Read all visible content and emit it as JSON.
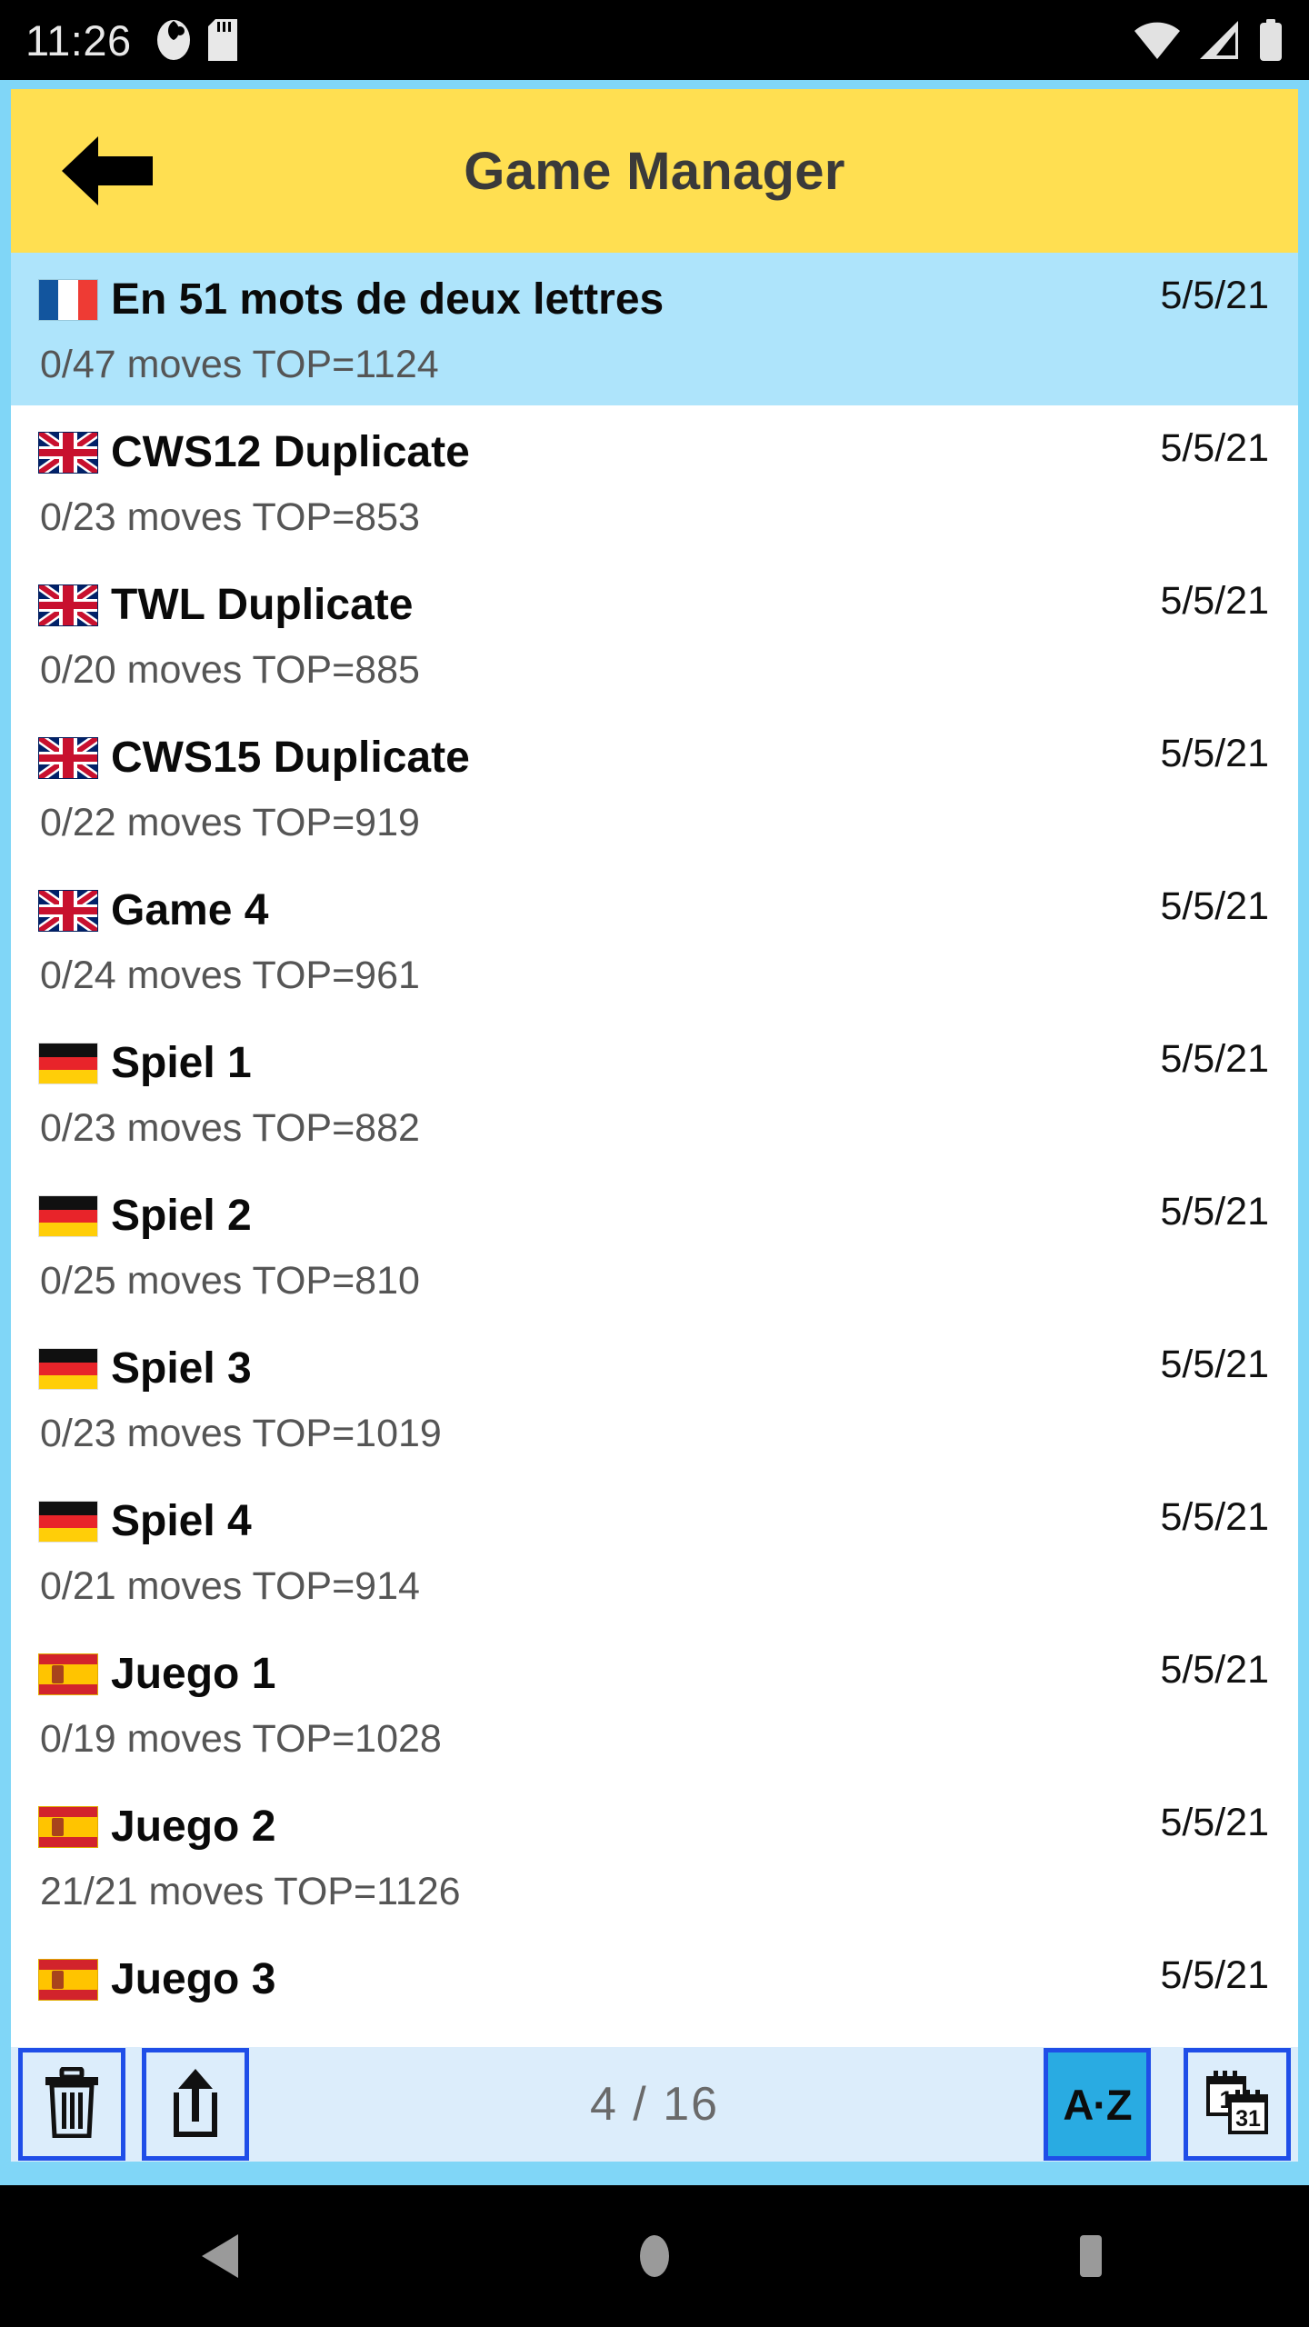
{
  "status_bar": {
    "time": "11:26",
    "left_icons": [
      "app-notification-icon",
      "sd-card-icon"
    ],
    "right_icons": [
      "wifi-icon",
      "cellular-signal-icon",
      "battery-icon"
    ]
  },
  "header": {
    "title": "Game Manager",
    "back_icon": "back-arrow-icon",
    "background_color": "#FFDF51",
    "title_color": "#3A3A3A"
  },
  "list": {
    "selected_index": 0,
    "selected_color": "#AEE4FB",
    "rows": [
      {
        "flag": "fr",
        "title": "En 51 mots de deux lettres",
        "subtitle": "0/47 moves TOP=1124",
        "date": "5/5/21"
      },
      {
        "flag": "gb",
        "title": "CWS12 Duplicate",
        "subtitle": "0/23 moves TOP=853",
        "date": "5/5/21"
      },
      {
        "flag": "gb",
        "title": "TWL Duplicate",
        "subtitle": "0/20 moves TOP=885",
        "date": "5/5/21"
      },
      {
        "flag": "gb",
        "title": "CWS15 Duplicate",
        "subtitle": "0/22 moves TOP=919",
        "date": "5/5/21"
      },
      {
        "flag": "gb",
        "title": "Game 4",
        "subtitle": "0/24 moves TOP=961",
        "date": "5/5/21"
      },
      {
        "flag": "de",
        "title": "Spiel 1",
        "subtitle": "0/23 moves TOP=882",
        "date": "5/5/21"
      },
      {
        "flag": "de",
        "title": "Spiel 2",
        "subtitle": "0/25 moves TOP=810",
        "date": "5/5/21"
      },
      {
        "flag": "de",
        "title": "Spiel 3",
        "subtitle": "0/23 moves TOP=1019",
        "date": "5/5/21"
      },
      {
        "flag": "de",
        "title": "Spiel 4",
        "subtitle": "0/21 moves TOP=914",
        "date": "5/5/21"
      },
      {
        "flag": "es",
        "title": "Juego 1",
        "subtitle": "0/19 moves TOP=1028",
        "date": "5/5/21"
      },
      {
        "flag": "es",
        "title": "Juego 2",
        "subtitle": "21/21 moves TOP=1126",
        "date": "5/5/21"
      },
      {
        "flag": "es",
        "title": "Juego 3",
        "subtitle": "",
        "date": "5/5/21"
      }
    ]
  },
  "toolbar": {
    "delete_icon": "trash-icon",
    "share_icon": "share-icon",
    "counter": "4 / 16",
    "sort_alpha_label": "A·Z",
    "sort_alpha_active": true,
    "sort_date_icon": "calendar-icon",
    "calendar_day_first": "1",
    "calendar_day_last": "31",
    "button_border_color": "#1F4EE8",
    "button_fill_color": "#DCEDFB",
    "active_fill_color": "#29ABE2"
  },
  "nav_bar": {
    "back": "nav-back-triangle-icon",
    "home": "nav-home-circle-icon",
    "recents": "nav-recents-square-icon"
  }
}
